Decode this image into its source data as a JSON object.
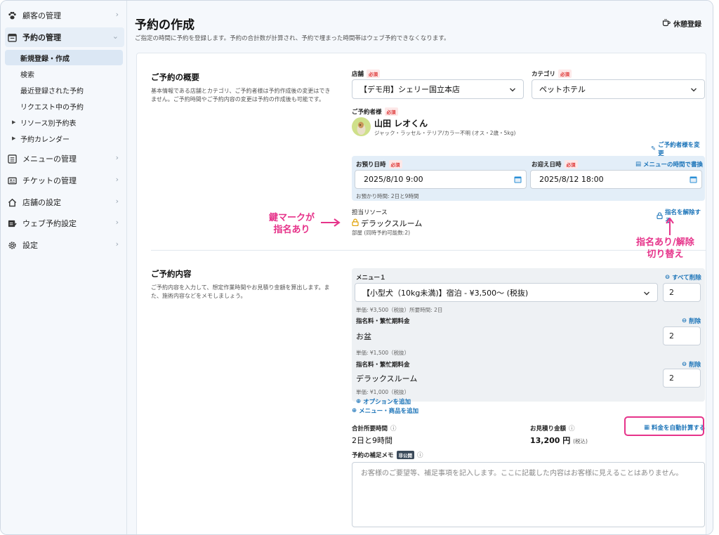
{
  "sidebar": {
    "items": [
      {
        "label": "顧客の管理",
        "icon": "paw-icon"
      },
      {
        "label": "予約の管理",
        "icon": "calendar-edit-icon"
      },
      {
        "label": "メニューの管理",
        "icon": "list-icon"
      },
      {
        "label": "チケットの管理",
        "icon": "ticket-icon"
      },
      {
        "label": "店舗の設定",
        "icon": "home-icon"
      },
      {
        "label": "ウェブ予約設定",
        "icon": "web-edit-icon"
      },
      {
        "label": "設定",
        "icon": "gear-icon"
      }
    ],
    "sub": [
      "新規登録・作成",
      "検索",
      "最近登録された予約",
      "リクエスト中の予約",
      "リソース別予約表",
      "予約カレンダー"
    ]
  },
  "header": {
    "title": "予約の作成",
    "subtitle": "ご指定の時間に予約を登録します。予約の合計数が計算され、予約で埋まった時間帯はウェブ予約できなくなります。",
    "break_label": "休憩登録"
  },
  "overview": {
    "title": "ご予約の概要",
    "desc": "基本情報である店舗とカテゴリ、ご予約者様は予約作成後の変更はできません。ご予約時間やご予約内容の変更は予約の作成後も可能です。",
    "store_label": "店舗",
    "store_value": "【デモ用】シェリー国立本店",
    "category_label": "カテゴリ",
    "category_value": "ペットホテル",
    "required": "必須",
    "customer_label": "ご予約者様",
    "customer_name": "山田 レオくん",
    "customer_detail": "ジャック・ラッセル・テリア/カラー不明 (オス・2歳・5kg)",
    "change_customer": "ご予約者様を変更",
    "checkin_label": "お預り日時",
    "checkin_value": "2025/8/10 9:00",
    "checkout_label": "お迎え日時",
    "checkout_value": "2025/8/12 18:00",
    "menu_time_link": "メニューの時間で書換",
    "duration_note": "お預かり時間: 2日と9時間",
    "resource_label": "担当リソース",
    "resource_value": "デラックスルーム",
    "resource_note": "部屋 (同時予約可能数:2)",
    "unassign": "指名を解除する"
  },
  "content": {
    "title": "ご予約内容",
    "desc": "ご予約内容を入力して、想定作業時間やお見積り金額を算出します。また、施術内容などをメモしましょう。",
    "menu_label": "メニュー１",
    "delete_all": "すべて削除",
    "menu_value": "【小型犬（10kg未満)】宿泊 - ¥3,500〜 (税抜)",
    "menu_qty": "2",
    "menu_note": "単価: ¥3,500（税抜）所要時間: 2日",
    "fee_label": "指名料・繁忙期料金",
    "delete": "削除",
    "fee1_name": "お盆",
    "fee1_qty": "2",
    "fee1_note": "単価: ¥1,500（税抜）",
    "fee2_name": "デラックスルーム",
    "fee2_qty": "2",
    "fee2_note": "単価: ¥1,000（税抜）",
    "add_option": "オプションを追加",
    "add_menu": "メニュー・商品を追加",
    "total_time_label": "合計所要時間",
    "total_time": "2日と9時間",
    "estimate_label": "お見積り金額",
    "estimate_value": "13,200 円",
    "tax_incl": "(税込)",
    "auto_calc": "料金を自動計算する",
    "memo_label": "予約の補足メモ",
    "memo_badge": "非公開",
    "memo_placeholder": "お客様のご要望等、補足事項を記入します。ここに記載した内容はお客様に見えることはありません。"
  },
  "annotations": {
    "lock": [
      "鍵マークが",
      "指名あり"
    ],
    "toggle": [
      "指名あり/解除",
      "切り替え"
    ]
  },
  "colors": {
    "accent": "#1a73b8",
    "annotation": "#e6338a",
    "required": "#d33"
  }
}
